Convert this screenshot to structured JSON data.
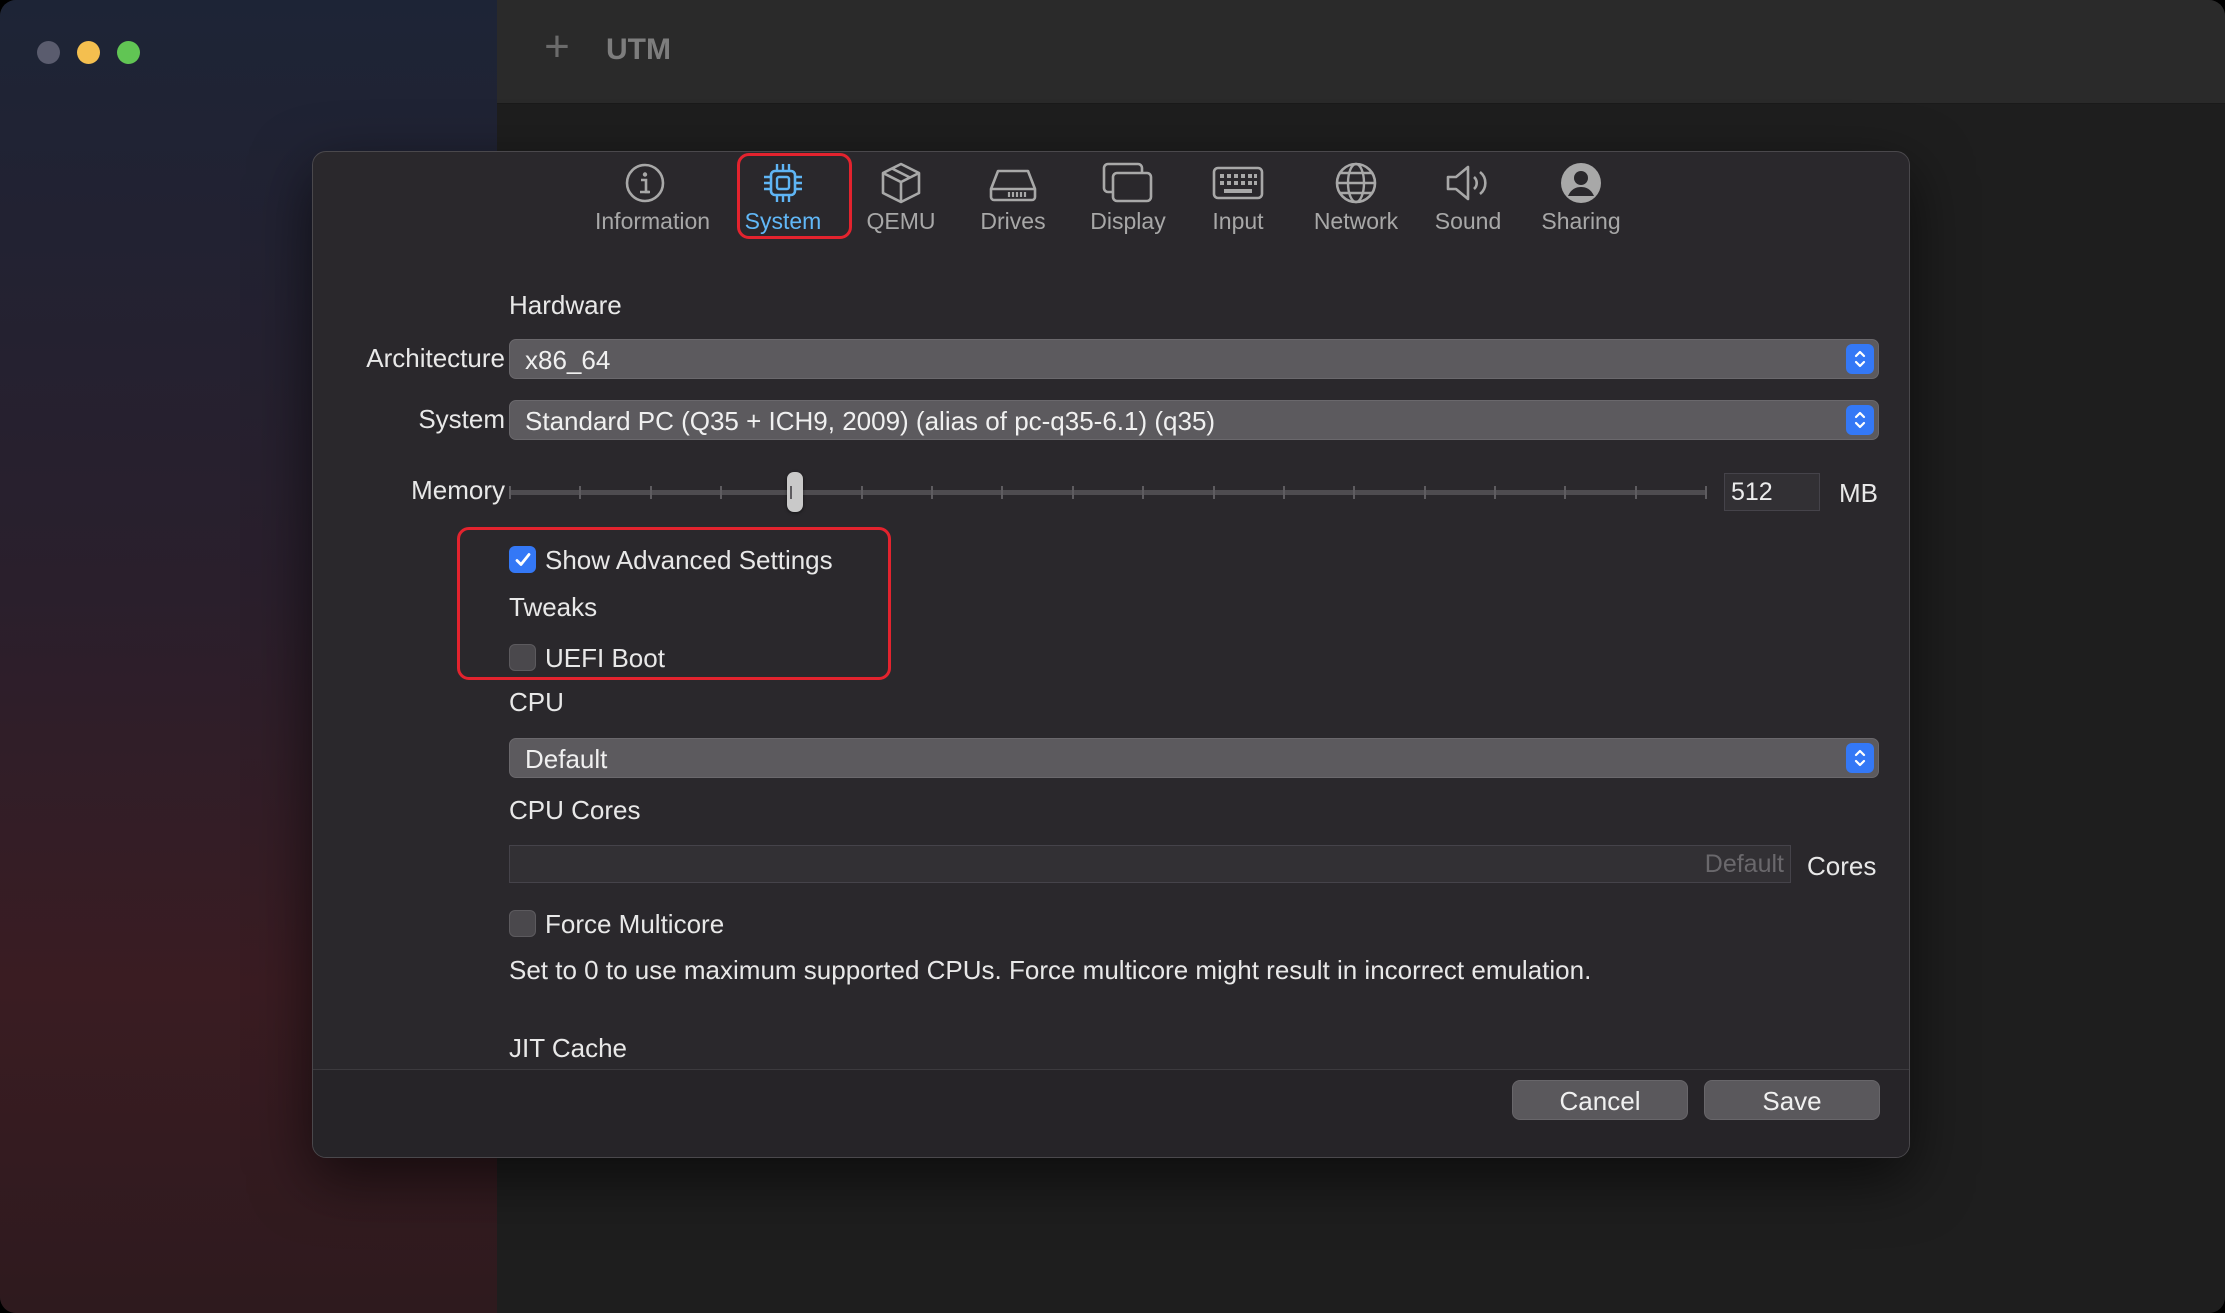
{
  "window": {
    "app_title": "UTM",
    "add_icon": "plus-icon"
  },
  "tabs": [
    {
      "label": "Information",
      "icon": "info-icon"
    },
    {
      "label": "System",
      "icon": "chip-icon"
    },
    {
      "label": "QEMU",
      "icon": "cube-icon"
    },
    {
      "label": "Drives",
      "icon": "drive-icon"
    },
    {
      "label": "Display",
      "icon": "display-icon"
    },
    {
      "label": "Input",
      "icon": "keyboard-icon"
    },
    {
      "label": "Network",
      "icon": "globe-icon"
    },
    {
      "label": "Sound",
      "icon": "speaker-icon"
    },
    {
      "label": "Sharing",
      "icon": "person-icon"
    }
  ],
  "active_tab": "System",
  "hardware": {
    "section_label": "Hardware",
    "architecture_label": "Architecture",
    "architecture_value": "x86_64",
    "system_label": "System",
    "system_value": "Standard PC (Q35 + ICH9, 2009) (alias of pc-q35-6.1) (q35)",
    "memory_label": "Memory",
    "memory_value": "512",
    "memory_unit": "MB"
  },
  "advanced": {
    "show_advanced_label": "Show Advanced Settings",
    "show_advanced_checked": true,
    "tweaks_label": "Tweaks",
    "uefi_boot_label": "UEFI Boot",
    "uefi_boot_checked": false
  },
  "cpu": {
    "section_label": "CPU",
    "cpu_value": "Default",
    "cores_label": "CPU Cores",
    "cores_placeholder": "Default",
    "cores_unit": "Cores",
    "force_multicore_label": "Force Multicore",
    "force_multicore_checked": false,
    "hint": "Set to 0 to use maximum supported CPUs. Force multicore might result in incorrect emulation."
  },
  "jit": {
    "section_label": "JIT Cache"
  },
  "footer": {
    "cancel_label": "Cancel",
    "save_label": "Save"
  },
  "colors": {
    "accent": "#3478f6",
    "active_tab": "#61b8f8",
    "highlight": "#e3232e"
  }
}
